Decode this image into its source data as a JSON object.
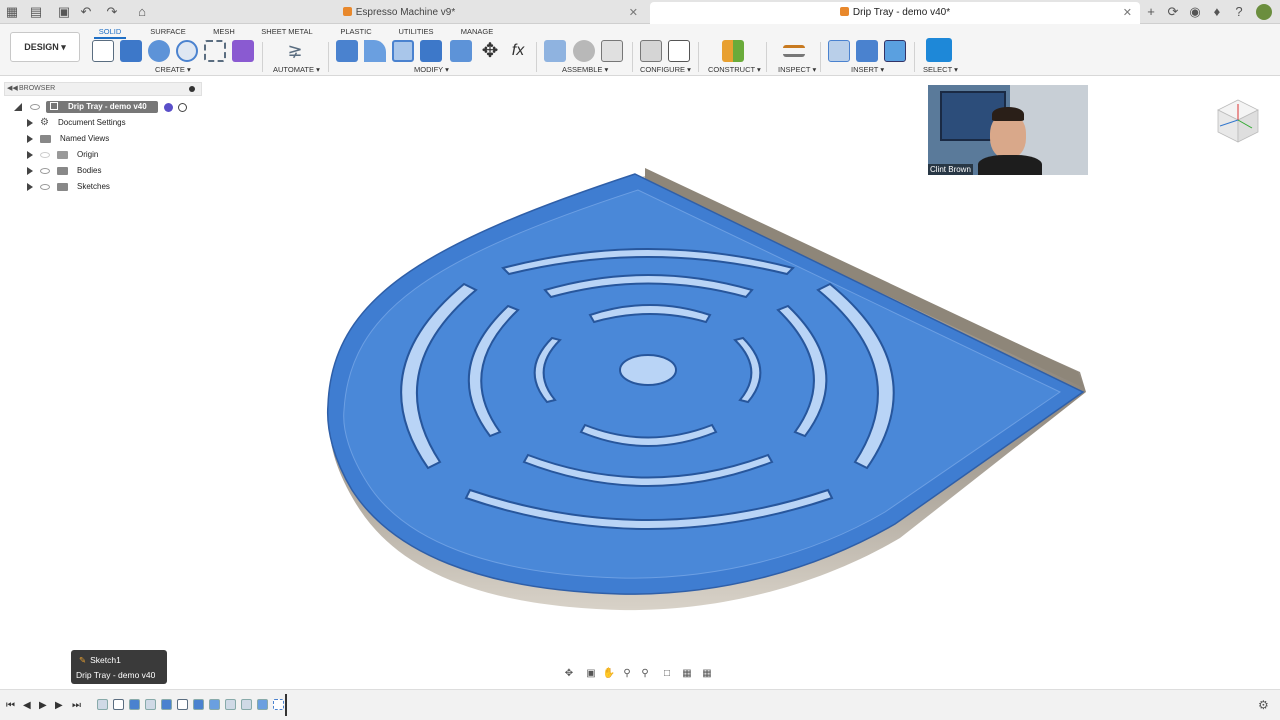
{
  "titlebar": {
    "tabs": [
      {
        "label": "Espresso Machine v9*",
        "active": false
      },
      {
        "label": "Drip Tray - demo v40*",
        "active": true
      }
    ],
    "icons": [
      "grid-icon",
      "file-icon",
      "save-icon",
      "undo-icon",
      "redo-icon",
      "home-icon",
      "new-tab-icon",
      "refresh-icon",
      "job-status-icon",
      "notification-icon",
      "help-icon",
      "user-avatar-icon"
    ]
  },
  "ribbon": {
    "workspace": "DESIGN",
    "tabs": [
      "SOLID",
      "SURFACE",
      "MESH",
      "SHEET METAL",
      "PLASTIC",
      "UTILITIES",
      "MANAGE"
    ],
    "groups": [
      "CREATE",
      "AUTOMATE",
      "MODIFY",
      "ASSEMBLE",
      "CONFIGURE",
      "CONSTRUCT",
      "INSPECT",
      "INSERT",
      "SELECT"
    ]
  },
  "browser": {
    "title": "BROWSER",
    "root": "Drip Tray - demo v40",
    "items": [
      "Document Settings",
      "Named Views",
      "Origin",
      "Bodies",
      "Sketches"
    ]
  },
  "webcam": {
    "name": "Clint Brown"
  },
  "tooltip": {
    "line1": "Sketch1",
    "line2": "Drip Tray - demo v40"
  },
  "colors": {
    "accent": "#1f6fc5",
    "model_blue": "#3f7dd1",
    "tab_orange": "#e8882c"
  }
}
